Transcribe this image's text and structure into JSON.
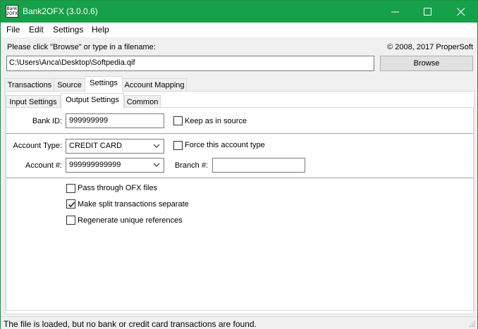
{
  "window": {
    "title": "Bank2OFX (3.0.0.6)",
    "icon_text_1": "Bank",
    "icon_text_2": "2OFX"
  },
  "menu": {
    "items": [
      "File",
      "Edit",
      "Settings",
      "Help"
    ]
  },
  "file": {
    "prompt": "Please click \"Browse\" or type in a filename:",
    "copyright": "© 2008, 2017 ProperSoft",
    "filename_value": "C:\\Users\\Anca\\Desktop\\Softpedia.qif",
    "browse_label": "Browse"
  },
  "tabs": {
    "main": [
      "Transactions",
      "Source",
      "Settings",
      "Account Mapping"
    ],
    "main_active": "Settings",
    "sub": [
      "Input Settings",
      "Output Settings",
      "Common"
    ],
    "sub_active": "Output Settings"
  },
  "output_settings": {
    "bank_id_label": "Bank ID:",
    "bank_id_value": "999999999",
    "keep_as_in_source_label": "Keep as in source",
    "keep_as_in_source_checked": false,
    "account_type_label": "Account Type:",
    "account_type_value": "CREDIT CARD",
    "force_account_type_label": "Force this account type",
    "force_account_type_checked": false,
    "account_number_label": "Account #:",
    "account_number_value": "999999999999",
    "branch_label": "Branch #:",
    "branch_value": "",
    "pass_through_label": "Pass through OFX files",
    "pass_through_checked": false,
    "split_transactions_label": "Make split transactions separate",
    "split_transactions_checked": true,
    "regenerate_label": "Regenerate unique references",
    "regenerate_checked": false
  },
  "status": {
    "text": "The file is loaded, but no bank or credit card transactions are found."
  },
  "colors": {
    "titlebar": "#15a049",
    "panel": "#ffffff",
    "background": "#f0f0f0"
  }
}
